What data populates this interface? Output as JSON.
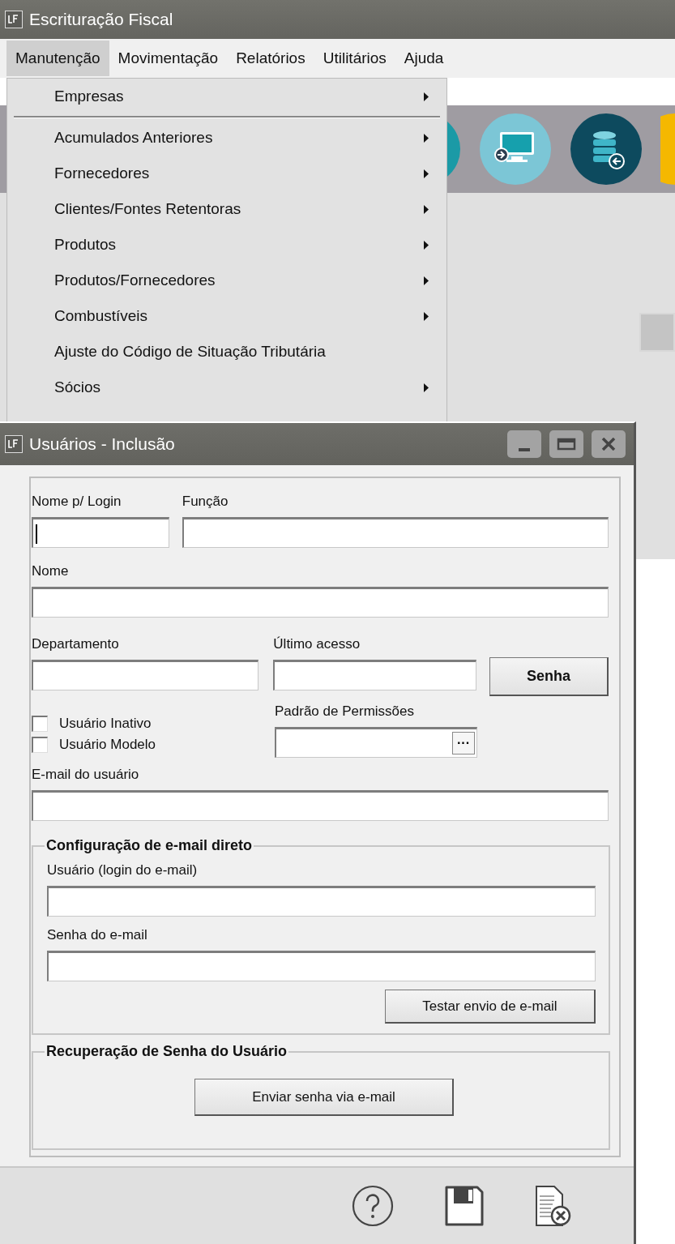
{
  "app": {
    "title": "Escrituração Fiscal"
  },
  "menu_bar": [
    {
      "label": "Manutenção",
      "selected": true
    },
    {
      "label": "Movimentação",
      "selected": false
    },
    {
      "label": "Relatórios",
      "selected": false
    },
    {
      "label": "Utilitários",
      "selected": false
    },
    {
      "label": "Ajuda",
      "selected": false
    }
  ],
  "dropdown": [
    {
      "kind": "item",
      "label": "Empresas",
      "submenu": true
    },
    {
      "kind": "separator"
    },
    {
      "kind": "item",
      "label": "Acumulados Anteriores",
      "submenu": true
    },
    {
      "kind": "item",
      "label": "Fornecedores",
      "submenu": true
    },
    {
      "kind": "item",
      "label": "Clientes/Fontes Retentoras",
      "submenu": true
    },
    {
      "kind": "item",
      "label": "Produtos",
      "submenu": true
    },
    {
      "kind": "item",
      "label": "Produtos/Fornecedores",
      "submenu": true
    },
    {
      "kind": "item",
      "label": "Combustíveis",
      "submenu": true
    },
    {
      "kind": "item",
      "label": "Ajuste do Código de Situação Tributária",
      "submenu": false
    },
    {
      "kind": "item",
      "label": "Sócios",
      "submenu": true
    }
  ],
  "dialog": {
    "title": "Usuários - Inclusão",
    "login_name": {
      "label": "Nome p/ Login",
      "focused": true
    },
    "function": {
      "label": "Função",
      "focused": false
    },
    "name": {
      "label": "Nome",
      "focused": false
    },
    "department": {
      "label": "Departamento",
      "focused": false
    },
    "last_access": {
      "label": "Último acesso",
      "focused": false
    },
    "password_button": "Senha",
    "checkboxes": [
      {
        "label": "Usuário Inativo",
        "checked": false
      },
      {
        "label": "Usuário Modelo",
        "checked": false
      }
    ],
    "permissions": {
      "label": "Padrão de Permissões",
      "button": "···"
    },
    "email": {
      "label": "E-mail do usuário",
      "focused": false
    },
    "direct_email": {
      "title": "Configuração de e-mail direto",
      "user": {
        "label": "Usuário (login do e-mail)",
        "focused": false
      },
      "password": {
        "label": "Senha do e-mail",
        "focused": false
      },
      "test_button": "Testar envio de e-mail"
    },
    "recovery": {
      "title": "Recuperação de Senha do Usuário",
      "send_button": "Enviar senha via e-mail"
    }
  }
}
